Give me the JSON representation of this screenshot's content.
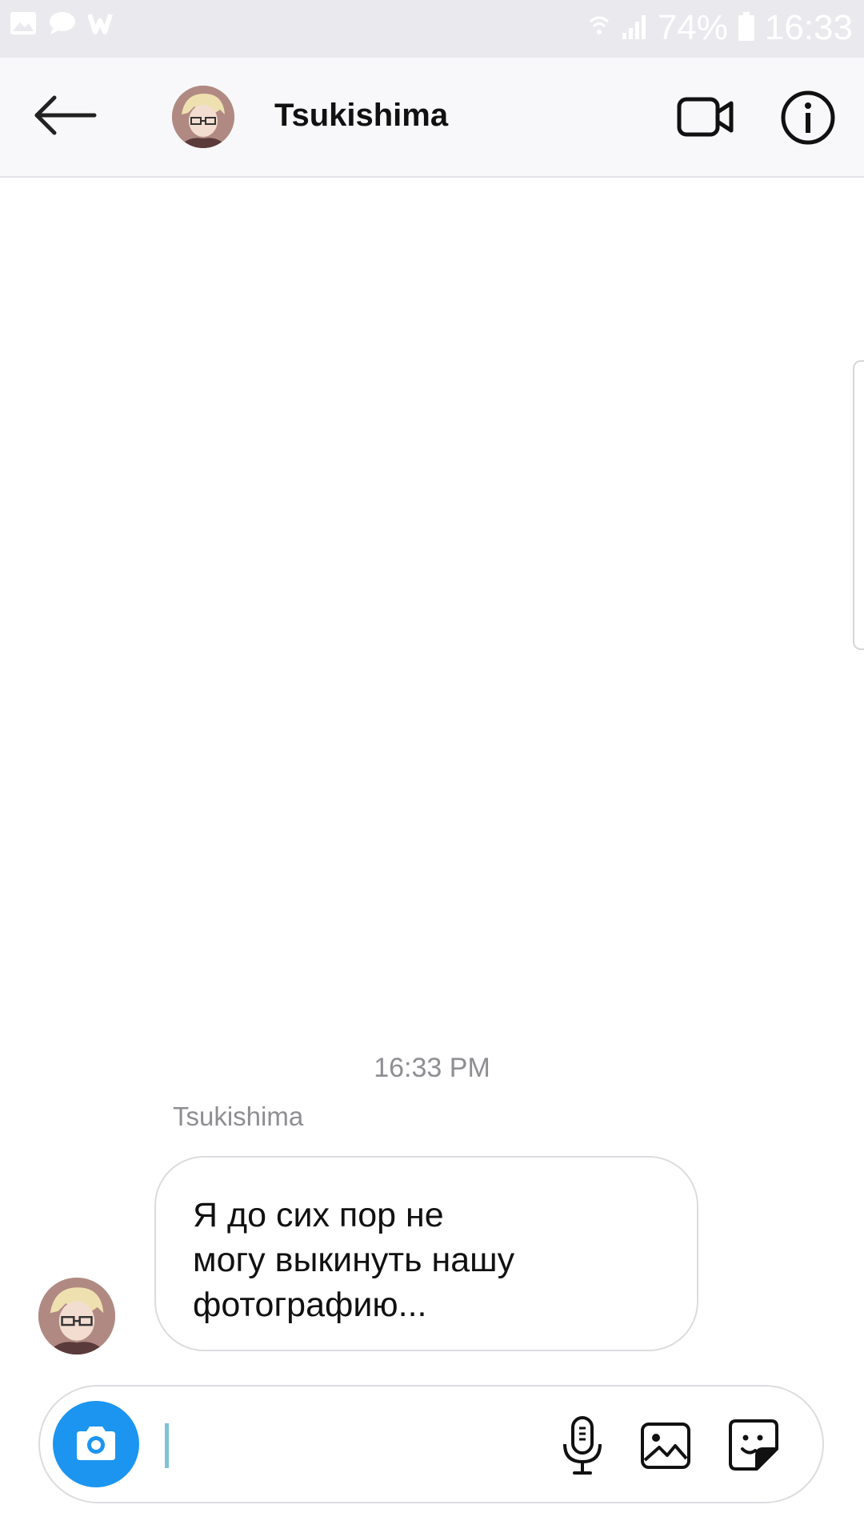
{
  "status_bar": {
    "battery": "74%",
    "time": "16:33",
    "left_icons": [
      "gallery-icon",
      "chat-icon",
      "wattpad-icon"
    ],
    "right_icons": [
      "wifi-icon",
      "signal-icon",
      "battery-icon"
    ]
  },
  "header": {
    "title": "Tsukishima",
    "icons": [
      "back-arrow-icon",
      "video-call-icon",
      "info-icon"
    ]
  },
  "chat": {
    "timestamp": "16:33 PM",
    "messages": [
      {
        "sender": "Tsukishima",
        "lines": [
          "Я до сих пор не",
          "могу выкинуть нашу",
          "фотографию..."
        ]
      }
    ]
  },
  "composer": {
    "placeholder": "",
    "icons": [
      "camera-icon",
      "microphone-icon",
      "gallery-icon",
      "sticker-icon"
    ]
  },
  "colors": {
    "accent": "#1b95f0",
    "header_bg": "#f8f8fa",
    "statusbar_bg": "#eaeaee",
    "muted_text": "#8e8e93",
    "border": "#dcdce0"
  }
}
